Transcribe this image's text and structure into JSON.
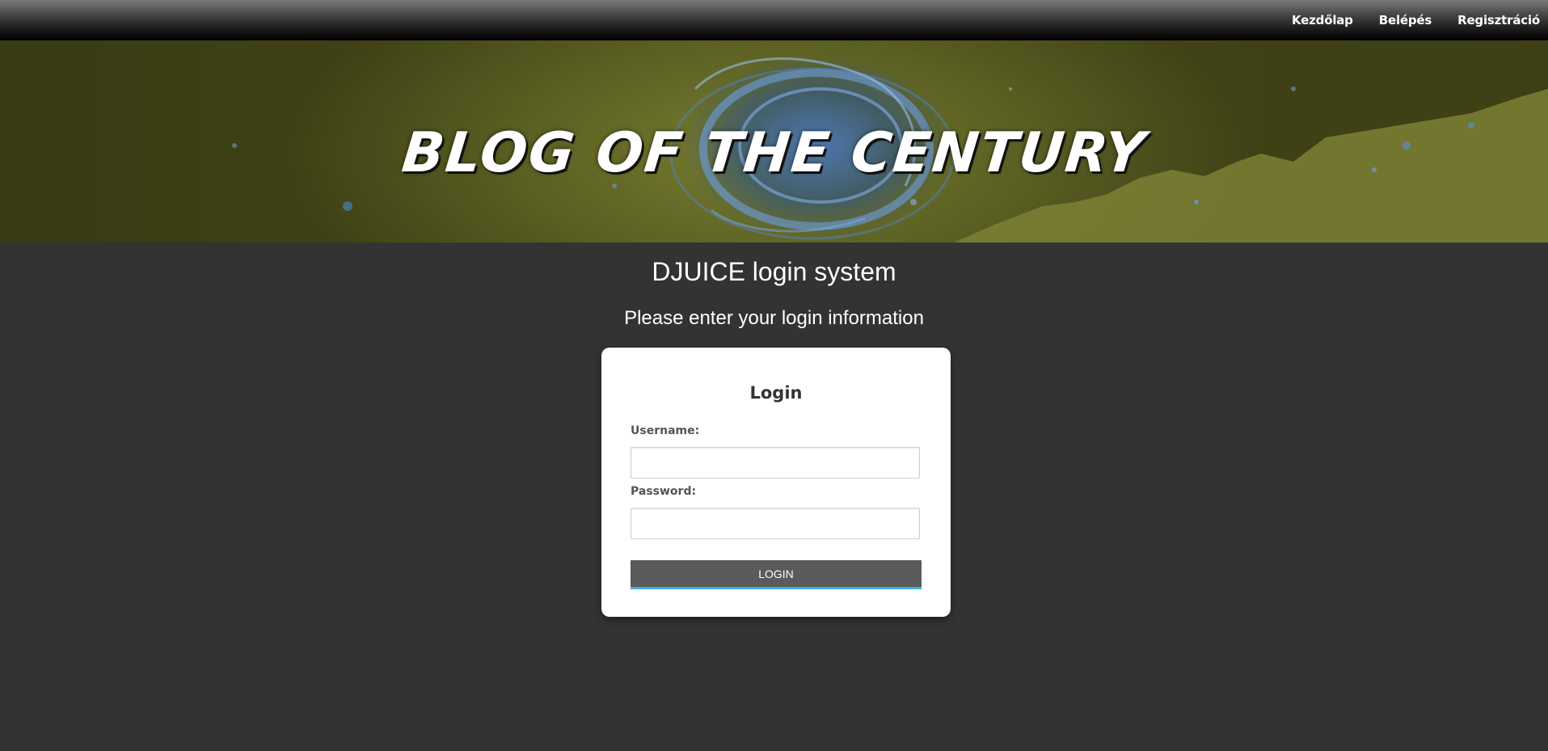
{
  "nav": {
    "items": [
      {
        "label": "Kezdőlap"
      },
      {
        "label": "Belépés"
      },
      {
        "label": "Regisztráció"
      }
    ]
  },
  "banner": {
    "title": "BLOG OF THE CENTURY"
  },
  "page": {
    "title": "DJUICE login system",
    "subtitle": "Please enter your login information"
  },
  "login_form": {
    "heading": "Login",
    "username_label": "Username:",
    "username_value": "",
    "password_label": "Password:",
    "password_value": "",
    "submit_label": "LOGIN"
  },
  "colors": {
    "background": "#333333",
    "button": "#5a5a5a",
    "button_accent": "#3fb0e6"
  }
}
